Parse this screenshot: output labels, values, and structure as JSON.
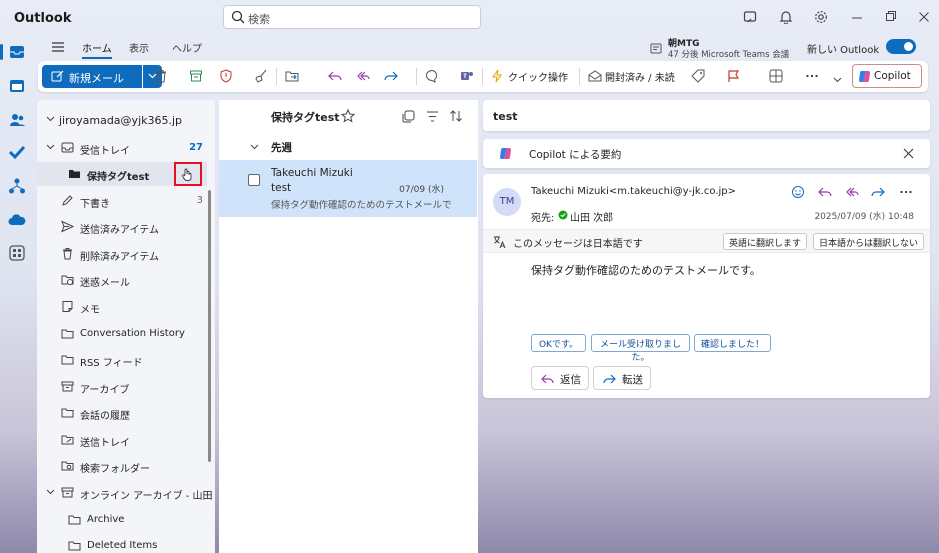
{
  "titlebar": {
    "app_title": "Outlook",
    "search_placeholder": "検索"
  },
  "topmenu": {
    "tabs": [
      "ホーム",
      "表示",
      "ヘルプ"
    ],
    "reminder_title": "朝MTG",
    "reminder_sub": "47 分後 Microsoft Teams 会議",
    "new_outlook_label": "新しい Outlook",
    "new_outlook_on": true
  },
  "ribbon": {
    "new_mail": "新規メール",
    "quick_steps": "クイック操作",
    "read_unread": "開封済み / 未読",
    "copilot": "Copilot"
  },
  "folders": {
    "account": "jiroyamada@yjk365.jp",
    "items": [
      {
        "label": "受信トレイ",
        "count": "27",
        "icon": "inbox-icon"
      },
      {
        "label": "保持タグtest",
        "count": "",
        "icon": "folder-icon"
      },
      {
        "label": "下書き",
        "count": "3",
        "icon": "pencil-icon"
      },
      {
        "label": "送信済みアイテム",
        "count": "",
        "icon": "send-icon"
      },
      {
        "label": "削除済みアイテム",
        "count": "",
        "icon": "trash-icon"
      },
      {
        "label": "迷惑メール",
        "count": "",
        "icon": "junk-icon"
      },
      {
        "label": "メモ",
        "count": "",
        "icon": "note-icon"
      },
      {
        "label": "Conversation History",
        "count": "",
        "icon": "folder-icon"
      },
      {
        "label": "RSS フィード",
        "count": "",
        "icon": "folder-icon"
      },
      {
        "label": "アーカイブ",
        "count": "",
        "icon": "archive-icon"
      },
      {
        "label": "会話の履歴",
        "count": "",
        "icon": "folder-icon"
      },
      {
        "label": "送信トレイ",
        "count": "",
        "icon": "outbox-icon"
      },
      {
        "label": "検索フォルダー",
        "count": "",
        "icon": "search-folder-icon"
      },
      {
        "label": "オンライン アーカイブ - 山田 ...",
        "count": "",
        "icon": "archive-icon"
      },
      {
        "label": "Archive",
        "count": "",
        "icon": "folder-icon"
      },
      {
        "label": "Deleted Items",
        "count": "",
        "icon": "folder-icon"
      }
    ]
  },
  "list": {
    "title": "保持タグtest",
    "group": "先週",
    "message": {
      "from": "Takeuchi Mizuki",
      "subject": "test",
      "date": "07/09 (水)",
      "preview": "保持タグ動作確認のためのテストメールで..."
    }
  },
  "reading": {
    "subject": "test",
    "copilot_summary": "Copilot による要約",
    "avatar": "TM",
    "sender": "Takeuchi Mizuki<m.takeuchi@y-jk.co.jp>",
    "to_label": "宛先:",
    "to_name": "山田 次郎",
    "date": "2025/07/09 (水) 10:48",
    "translate_text": "このメッセージは日本語です",
    "translate_btn": "英語に翻訳します",
    "no_translate_btn": "日本語からは翻訳しない",
    "body": "保持タグ動作確認のためのテストメールです。",
    "suggestions": [
      "OKです。",
      "メール受け取りました。",
      "確認しました！"
    ],
    "reply": "返信",
    "forward": "転送"
  },
  "colors": {
    "accent": "#0f6cbd",
    "selected": "#cfe4fa",
    "highlight": "#e81123"
  }
}
